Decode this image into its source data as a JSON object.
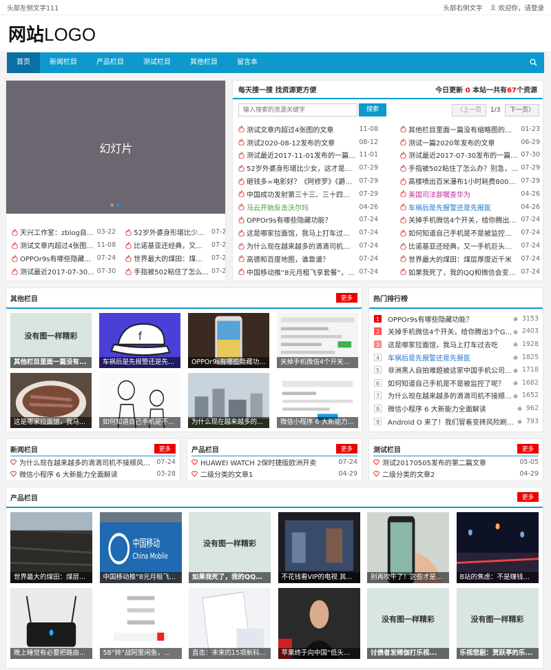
{
  "topbar": {
    "left": "头部左侧文字111",
    "right": "头部右侧文字",
    "welcome": "欢迎你，请登录"
  },
  "logo": {
    "bold": "网站",
    "text": "LOGO"
  },
  "nav": [
    {
      "label": "首页",
      "active": true
    },
    {
      "label": "新闻栏目"
    },
    {
      "label": "产品栏目"
    },
    {
      "label": "测试栏目"
    },
    {
      "label": "其他栏目"
    },
    {
      "label": "留言本"
    }
  ],
  "slider": {
    "label": "幻灯片"
  },
  "slide_list": [
    {
      "t": "天兴工作室：zblog自...",
      "d": "03-22"
    },
    {
      "t": "52岁外婆身形堪比少...",
      "d": "07-29"
    },
    {
      "t": "测试文章内超过4张图...",
      "d": "11-08"
    },
    {
      "t": "比诺基亚还经典，又...",
      "d": "07-24"
    },
    {
      "t": "OPPOr9s有哪些隐藏...",
      "d": "07-24"
    },
    {
      "t": "世界最大的煤田：煤...",
      "d": "07-24"
    },
    {
      "t": "测试最近2017-07-30...",
      "d": "07-30"
    },
    {
      "t": "手指被502粘住了怎么...",
      "d": "07-29"
    }
  ],
  "search_panel": {
    "title": "每天搜一搜 找资源更方便",
    "update_prefix": "今日更新",
    "update_count": "0",
    "total_prefix": "本站一共有",
    "total_count": "67",
    "total_suffix": "个资源",
    "placeholder": "输入搜索的资源关键字",
    "button": "搜索",
    "prev": "上一页",
    "page": "1/3",
    "next": "下一页",
    "col1": [
      {
        "t": "测试文章内超过4张图的文章",
        "d": "11-08"
      },
      {
        "t": "测试2020-08-12发布的文章",
        "d": "08-12"
      },
      {
        "t": "测试最近2017-11-01发布的一篇文字",
        "d": "11-01"
      },
      {
        "t": "52岁外婆身形堪比少女，这才是她...",
        "d": "07-29"
      },
      {
        "t": "砸钱多=电影好？《阿修罗》《爵迹...",
        "d": "07-29"
      },
      {
        "t": "中国成功发射第三十三、三十四颗...",
        "d": "07-29"
      },
      {
        "t": "马云开始反击沃尔玛",
        "d": "04-26",
        "color": "#3a9a3a"
      },
      {
        "t": "OPPOr9s有哪些隐藏功能？",
        "d": "07-24"
      },
      {
        "t": "这是哪家拉面馆，我马上打车过去吃",
        "d": "07-24"
      },
      {
        "t": "为什么现在越来越多的滴滴司机不...",
        "d": "07-24"
      },
      {
        "t": "高德和百度地图，谁靠谱？",
        "d": "07-24"
      },
      {
        "t": "中国移动推“8元月租飞享套餐”，...",
        "d": "07-24"
      }
    ],
    "col2": [
      {
        "t": "其他栏目里面一篇没有缩略图的测...",
        "d": "01-23"
      },
      {
        "t": "测试一篇2020年发布的文章",
        "d": "06-29"
      },
      {
        "t": "测试最近2017-07-30发布的一篇文字",
        "d": "07-30"
      },
      {
        "t": "手指被502粘住了怎么办？别急，方...",
        "d": "07-29"
      },
      {
        "t": "高楼喷出百米瀑布1小时耗费800元？",
        "d": "07-29"
      },
      {
        "t": "美国司法部嘱查华为",
        "d": "04-26",
        "color": "#c0289a"
      },
      {
        "t": "车祸后是先报警还是先报医",
        "d": "04-26",
        "color": "#1e74c8"
      },
      {
        "t": "关掉手机微信4个开关，给你腾出3...",
        "d": "07-24"
      },
      {
        "t": "如何知道自己手机是不是被监控了...",
        "d": "07-24"
      },
      {
        "t": "比诺基亚还经典，又一手机巨头回...",
        "d": "07-24"
      },
      {
        "t": "世界最大的煤田：煤层厚度近千米",
        "d": "07-24"
      },
      {
        "t": "如果我死了，我的QQ和微信会变成...",
        "d": "07-24"
      }
    ]
  },
  "other": {
    "title": "其他栏目",
    "more": "更多",
    "items": [
      {
        "cap": "其他栏目里面一篇没有...",
        "noimg": "没有图一样精彩"
      },
      {
        "cap": "车祸后是先报警还是先..."
      },
      {
        "cap": "OPPOr9s有哪些隐藏功..."
      },
      {
        "cap": "关掉手机微信4个开关..."
      },
      {
        "cap": "这是哪家拉面馆，我马..."
      },
      {
        "cap": "如何知道自己手机是不..."
      },
      {
        "cap": "为什么现在越来越多的..."
      },
      {
        "cap": "微信小程序 6 大新能力..."
      }
    ]
  },
  "hot": {
    "title": "热门排行榜",
    "items": [
      {
        "n": "1",
        "t": "OPPOr9s有哪些隐藏功能？",
        "c": "3153"
      },
      {
        "n": "2",
        "t": "关掉手机微信4个开关，给你腾出3个G...",
        "c": "2403"
      },
      {
        "n": "3",
        "t": "这是哪家拉面馆，我马上打车过去吃",
        "c": "1928"
      },
      {
        "n": "4",
        "t": "车祸后是先报警还是先报医",
        "c": "1825",
        "color": "#1e74c8"
      },
      {
        "n": "5",
        "t": "非洲黑人自拍难题被这家中国手机公司...",
        "c": "1718"
      },
      {
        "n": "6",
        "t": "如何知道自己手机是不是被监控了呢？",
        "c": "1682"
      },
      {
        "n": "7",
        "t": "为什么现在越来越多的滴滴司机不接顺...",
        "c": "1652"
      },
      {
        "n": "8",
        "t": "微信小程序 6 大新能力全面解读",
        "c": "962"
      },
      {
        "n": "9",
        "t": "Android O 来了！我们冒着变砖风险刷机...",
        "c": "793"
      }
    ]
  },
  "cols3": [
    {
      "title": "新闻栏目",
      "more": "更多",
      "items": [
        {
          "t": "为什么现在越来越多的滴滴司机不接顺风车...",
          "d": "07-24"
        },
        {
          "t": "微信小程序 6 大新能力全面解读",
          "d": "03-28"
        }
      ]
    },
    {
      "title": "产品栏目",
      "more": "更多",
      "items": [
        {
          "t": "HUAWEI WATCH 2保时捷版欧洲开卖",
          "d": "07-24"
        },
        {
          "t": "二级分类的文章1",
          "d": "04-29"
        }
      ]
    },
    {
      "title": "测试栏目",
      "more": "更多",
      "items": [
        {
          "t": "测试20170505发布的第二篇文章",
          "d": "05-05"
        },
        {
          "t": "二级分类的文章2",
          "d": "04-29"
        }
      ]
    }
  ],
  "products": {
    "title": "产品栏目",
    "more": "更多",
    "items": [
      {
        "cap": "世界最大的煤田：煤层..."
      },
      {
        "cap": "中国移动推“8元月租飞..."
      },
      {
        "cap": "如果我死了，我的QQ和...",
        "noimg": "没有图一样精彩"
      },
      {
        "cap": "不花钱看VIP的电视 其..."
      },
      {
        "cap": "别再吹牛了！这些才是2..."
      },
      {
        "cap": "B站的焦虑：不是赚钱而..."
      },
      {
        "cap": "晚上睡觉有必要把路由..."
      },
      {
        "cap": "58“转”战阿里闲鱼，..."
      },
      {
        "cap": "直击：未来的15项新科..."
      },
      {
        "cap": "苹果终于向中国“低头..."
      },
      {
        "cap": "讨债者发稀伽打乐视...",
        "noimg": "没有图一样精彩"
      },
      {
        "cap": "乐视悲剧：贾跃亭的乐...",
        "noimg": "没有图一样精彩"
      }
    ]
  }
}
